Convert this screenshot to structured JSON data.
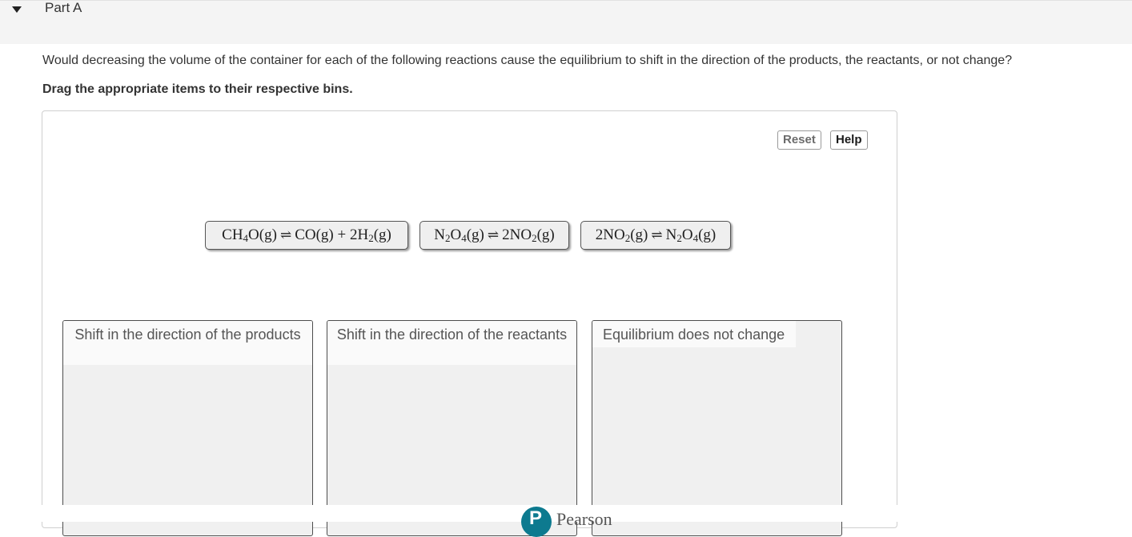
{
  "part": {
    "title": "Part A",
    "expanded": true
  },
  "question": "Would decreasing the volume of the container for each of the following reactions cause the equilibrium to shift in the direction of the products, the reactants, or not change?",
  "instruction": "Drag the appropriate items to their respective bins.",
  "toolbar": {
    "reset_label": "Reset",
    "help_label": "Help"
  },
  "tokens": [
    {
      "text": "CH4O(g) ⇌ CO(g) + 2H2(g)"
    },
    {
      "text": "N2O4(g) ⇌ 2NO2(g)"
    },
    {
      "text": "2NO2(g) ⇌ N2O4(g)"
    }
  ],
  "bins": [
    {
      "label": "Shift in the direction of the products"
    },
    {
      "label": "Shift in the direction of the reactants"
    },
    {
      "label": "Equilibrium does not change"
    }
  ],
  "footer": {
    "brand": "Pearson",
    "logo_letter": "P",
    "brand_color": "#0d7a8f"
  },
  "colors": {
    "header_bg": "#f4f4f4",
    "token_bg": "#efefef",
    "bin_bg": "#f0f0f0"
  }
}
